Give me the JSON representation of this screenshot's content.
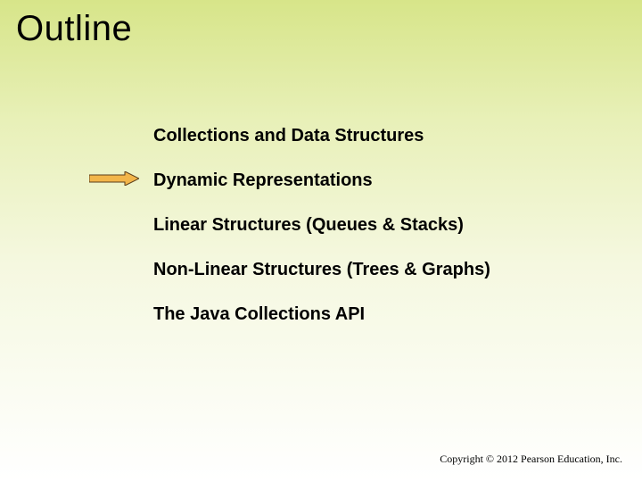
{
  "title": "Outline",
  "items": [
    "Collections and Data Structures",
    "Dynamic Representations",
    "Linear Structures (Queues & Stacks)",
    "Non-Linear Structures (Trees & Graphs)",
    "The Java Collections API"
  ],
  "arrow_target_index": 1,
  "footer": "Copyright © 2012 Pearson Education, Inc."
}
